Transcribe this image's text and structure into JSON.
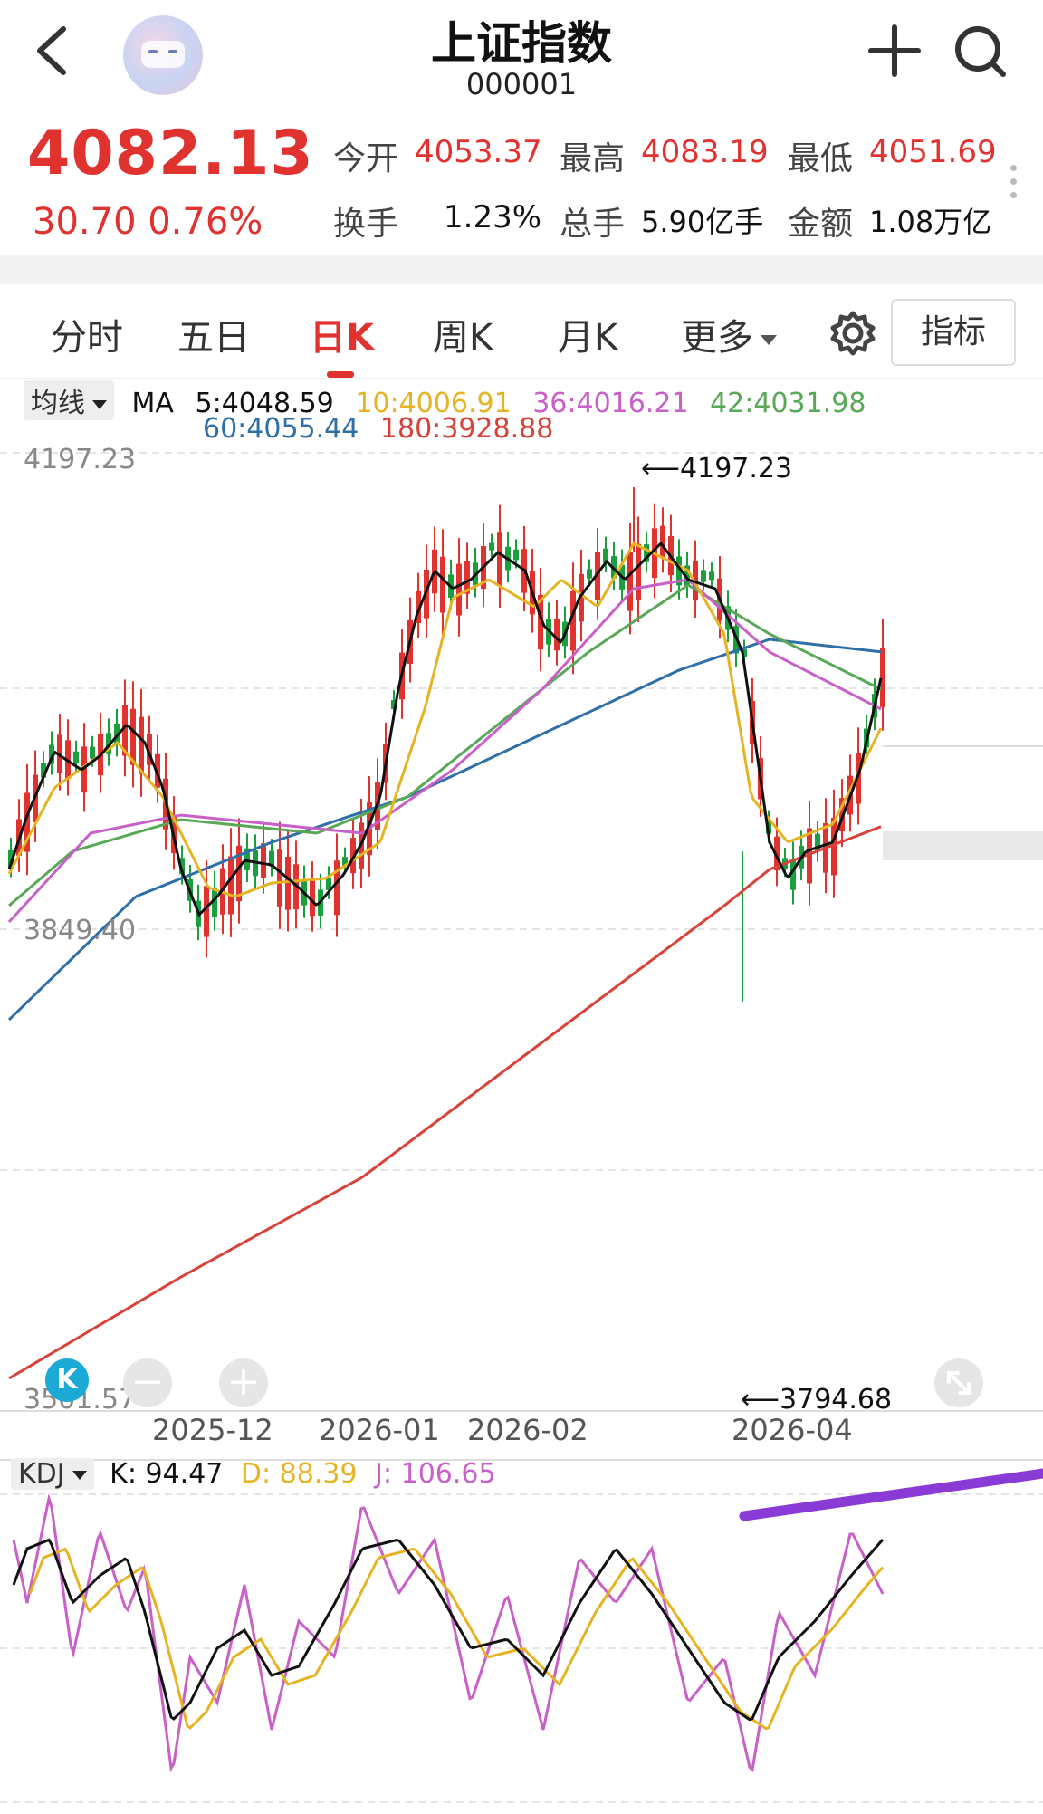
{
  "header": {
    "title": "上证指数",
    "code": "000001"
  },
  "quote": {
    "price": "4082.13",
    "change": "30.70 0.76%",
    "stats": [
      {
        "label": "今开",
        "value": "4053.37"
      },
      {
        "label": "最高",
        "value": "4083.19"
      },
      {
        "label": "最低",
        "value": "4051.69"
      },
      {
        "label": "换手",
        "value": "1.23%"
      },
      {
        "label": "总手",
        "value": "5.90亿手"
      },
      {
        "label": "金额",
        "value": "1.08万亿"
      }
    ]
  },
  "tabs": [
    {
      "label": "分时"
    },
    {
      "label": "五日"
    },
    {
      "label": "日K",
      "active": true
    },
    {
      "label": "周K"
    },
    {
      "label": "月K"
    },
    {
      "label": "更多"
    }
  ],
  "indicator_button": "指标",
  "ma": {
    "selector": "均线",
    "prefix": "MA",
    "items": [
      {
        "text": "5:4048.59",
        "color": "#111111"
      },
      {
        "text": "10:4006.91",
        "color": "#e6b422"
      },
      {
        "text": "36:4016.21",
        "color": "#c860c8"
      },
      {
        "text": "42:4031.98",
        "color": "#58a858"
      },
      {
        "text": "60:4055.44",
        "color": "#2f6fa8"
      },
      {
        "text": "180:3928.88",
        "color": "#d8423a"
      }
    ]
  },
  "colors": {
    "up": "#e0322f",
    "down": "#1b9e3e",
    "ma5": "#111111",
    "ma10": "#e6b422",
    "ma36": "#c860c8",
    "ma42": "#58a858",
    "ma60": "#2f6fa8",
    "ma180": "#d8423a"
  },
  "axis": {
    "top": "4197.23",
    "mid": "3849.40",
    "bottom": "3501.57",
    "high_marker": "4197.23",
    "low_marker": "3794.68",
    "x_labels": [
      "2025-12",
      "2026-01",
      "2026-02",
      "2026-04"
    ]
  },
  "kdj": {
    "selector": "KDJ",
    "k": "K: 94.47",
    "d": "D: 88.39",
    "j": "J: 106.65"
  },
  "chart_data": {
    "type": "candlestick",
    "title": "上证指数",
    "y_range": [
      3501.57,
      4197.23
    ],
    "high": 4197.23,
    "low": 3794.68,
    "x_labels": [
      "2025-12",
      "2026-01",
      "2026-02",
      "2026-04"
    ],
    "moving_averages": [
      {
        "name": "MA5",
        "value": 4048.59
      },
      {
        "name": "MA10",
        "value": 4006.91
      },
      {
        "name": "MA36",
        "value": 4016.21
      },
      {
        "name": "MA42",
        "value": 4031.98
      },
      {
        "name": "MA60",
        "value": 4055.44
      },
      {
        "name": "MA180",
        "value": 3928.88
      }
    ],
    "kdj": {
      "K": 94.47,
      "D": 88.39,
      "J": 106.65
    }
  }
}
